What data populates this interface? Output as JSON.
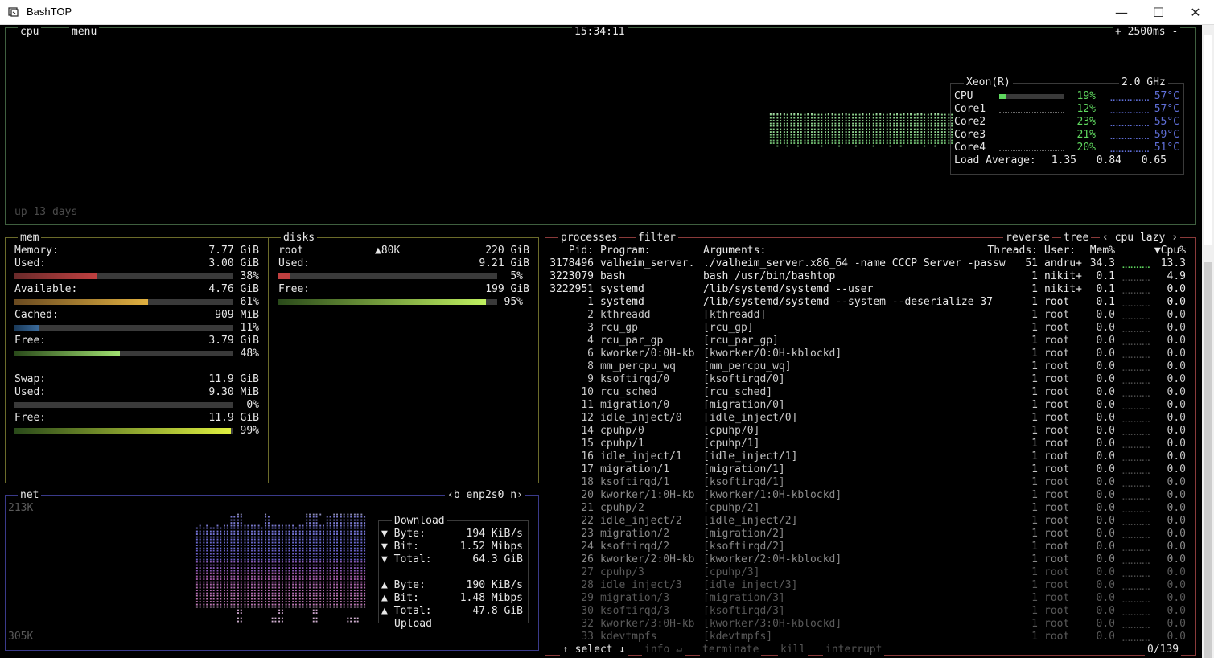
{
  "window": {
    "title": "BashTOP",
    "minimize": "—",
    "maximize": "☐",
    "close": "✕"
  },
  "cpu": {
    "label": "cpu",
    "menu": "menu",
    "clock": "15:34:11",
    "interval": "+ 2500ms -",
    "uptime": "up 13 days",
    "model": "Xeon(R)",
    "freq": "2.0 GHz",
    "rows": [
      {
        "name": "CPU",
        "pct": "19%",
        "temp": "57°C",
        "level": 0.19
      },
      {
        "name": "Core1",
        "pct": "12%",
        "temp": "57°C",
        "level": 0.12
      },
      {
        "name": "Core2",
        "pct": "23%",
        "temp": "55°C",
        "level": 0.23
      },
      {
        "name": "Core3",
        "pct": "21%",
        "temp": "59°C",
        "level": 0.21
      },
      {
        "name": "Core4",
        "pct": "20%",
        "temp": "51°C",
        "level": 0.2
      }
    ],
    "load_label": "Load Average:",
    "load": [
      "1.35",
      "0.84",
      "0.65"
    ]
  },
  "mem": {
    "label": "mem",
    "memory": {
      "label": "Memory:",
      "value": "7.77 GiB"
    },
    "used": {
      "label": "Used:",
      "value": "3.00 GiB",
      "pct": "38%",
      "level": 0.38
    },
    "available": {
      "label": "Available:",
      "value": "4.76 GiB",
      "pct": "61%",
      "level": 0.61
    },
    "cached": {
      "label": "Cached:",
      "value": "909 MiB",
      "pct": "11%",
      "level": 0.11
    },
    "free": {
      "label": "Free:",
      "value": "3.79 GiB",
      "pct": "48%",
      "level": 0.48
    },
    "swap": {
      "label": "Swap:",
      "value": "11.9 GiB"
    },
    "swap_used": {
      "label": "Used:",
      "value": "9.30 MiB",
      "pct": "0%",
      "level": 0.0
    },
    "swap_free": {
      "label": "Free:",
      "value": "11.9 GiB",
      "pct": "99%",
      "level": 0.99
    }
  },
  "disks": {
    "label": "disks",
    "name": "root",
    "io": "▲80K",
    "total": "220 GiB",
    "used": {
      "label": "Used:",
      "value": "9.21 GiB",
      "pct": "5%",
      "level": 0.05
    },
    "free": {
      "label": "Free:",
      "value": "199 GiB",
      "pct": "95%",
      "level": 0.95
    }
  },
  "net": {
    "label": "net",
    "interface": "‹b enp2s0 n›",
    "top_scale": "213K",
    "bottom_scale": "305K",
    "download": {
      "title": "Download",
      "byte_label": "▼ Byte:",
      "byte": "194 KiB/s",
      "bit_label": "▼ Bit:",
      "bit": "1.52 Mibps",
      "total_label": "▼ Total:",
      "total": "64.3 GiB"
    },
    "upload": {
      "title": "Upload",
      "byte_label": "▲ Byte:",
      "byte": "190 KiB/s",
      "bit_label": "▲ Bit:",
      "bit": "1.48 Mibps",
      "total_label": "▲ Total:",
      "total": "47.8 GiB"
    }
  },
  "proc": {
    "label": "processes",
    "filter": "filter",
    "reverse": "reverse",
    "tree": "tree",
    "sort": "‹ cpu lazy ›",
    "headers": {
      "pid": "Pid:",
      "program": "Program:",
      "args": "Arguments:",
      "threads": "Threads:",
      "user": "User:",
      "mem": "Mem%",
      "cpu": "▼Cpu%"
    },
    "rows": [
      {
        "pid": "3178496",
        "program": "valheim_server.",
        "args": "./valheim_server.x86_64 -name CCCP Server -passw",
        "threads": "51",
        "user": "andru+",
        "mem": "34.3",
        "cpu": "13.3"
      },
      {
        "pid": "3223079",
        "program": "bash",
        "args": "bash /usr/bin/bashtop",
        "threads": "1",
        "user": "nikit+",
        "mem": "0.1",
        "cpu": "4.9"
      },
      {
        "pid": "3222951",
        "program": "systemd",
        "args": "/lib/systemd/systemd --user",
        "threads": "1",
        "user": "nikit+",
        "mem": "0.1",
        "cpu": "0.0"
      },
      {
        "pid": "1",
        "program": "systemd",
        "args": "/lib/systemd/systemd --system --deserialize 37",
        "threads": "1",
        "user": "root",
        "mem": "0.1",
        "cpu": "0.0"
      },
      {
        "pid": "2",
        "program": "kthreadd",
        "args": "[kthreadd]",
        "threads": "1",
        "user": "root",
        "mem": "0.0",
        "cpu": "0.0"
      },
      {
        "pid": "3",
        "program": "rcu_gp",
        "args": "[rcu_gp]",
        "threads": "1",
        "user": "root",
        "mem": "0.0",
        "cpu": "0.0"
      },
      {
        "pid": "4",
        "program": "rcu_par_gp",
        "args": "[rcu_par_gp]",
        "threads": "1",
        "user": "root",
        "mem": "0.0",
        "cpu": "0.0"
      },
      {
        "pid": "6",
        "program": "kworker/0:0H-kb",
        "args": "[kworker/0:0H-kblockd]",
        "threads": "1",
        "user": "root",
        "mem": "0.0",
        "cpu": "0.0"
      },
      {
        "pid": "8",
        "program": "mm_percpu_wq",
        "args": "[mm_percpu_wq]",
        "threads": "1",
        "user": "root",
        "mem": "0.0",
        "cpu": "0.0"
      },
      {
        "pid": "9",
        "program": "ksoftirqd/0",
        "args": "[ksoftirqd/0]",
        "threads": "1",
        "user": "root",
        "mem": "0.0",
        "cpu": "0.0"
      },
      {
        "pid": "10",
        "program": "rcu_sched",
        "args": "[rcu_sched]",
        "threads": "1",
        "user": "root",
        "mem": "0.0",
        "cpu": "0.0"
      },
      {
        "pid": "11",
        "program": "migration/0",
        "args": "[migration/0]",
        "threads": "1",
        "user": "root",
        "mem": "0.0",
        "cpu": "0.0"
      },
      {
        "pid": "12",
        "program": "idle_inject/0",
        "args": "[idle_inject/0]",
        "threads": "1",
        "user": "root",
        "mem": "0.0",
        "cpu": "0.0"
      },
      {
        "pid": "14",
        "program": "cpuhp/0",
        "args": "[cpuhp/0]",
        "threads": "1",
        "user": "root",
        "mem": "0.0",
        "cpu": "0.0"
      },
      {
        "pid": "15",
        "program": "cpuhp/1",
        "args": "[cpuhp/1]",
        "threads": "1",
        "user": "root",
        "mem": "0.0",
        "cpu": "0.0"
      },
      {
        "pid": "16",
        "program": "idle_inject/1",
        "args": "[idle_inject/1]",
        "threads": "1",
        "user": "root",
        "mem": "0.0",
        "cpu": "0.0"
      },
      {
        "pid": "17",
        "program": "migration/1",
        "args": "[migration/1]",
        "threads": "1",
        "user": "root",
        "mem": "0.0",
        "cpu": "0.0"
      },
      {
        "pid": "18",
        "program": "ksoftirqd/1",
        "args": "[ksoftirqd/1]",
        "threads": "1",
        "user": "root",
        "mem": "0.0",
        "cpu": "0.0"
      },
      {
        "pid": "20",
        "program": "kworker/1:0H-kb",
        "args": "[kworker/1:0H-kblockd]",
        "threads": "1",
        "user": "root",
        "mem": "0.0",
        "cpu": "0.0"
      },
      {
        "pid": "21",
        "program": "cpuhp/2",
        "args": "[cpuhp/2]",
        "threads": "1",
        "user": "root",
        "mem": "0.0",
        "cpu": "0.0"
      },
      {
        "pid": "22",
        "program": "idle_inject/2",
        "args": "[idle_inject/2]",
        "threads": "1",
        "user": "root",
        "mem": "0.0",
        "cpu": "0.0"
      },
      {
        "pid": "23",
        "program": "migration/2",
        "args": "[migration/2]",
        "threads": "1",
        "user": "root",
        "mem": "0.0",
        "cpu": "0.0"
      },
      {
        "pid": "24",
        "program": "ksoftirqd/2",
        "args": "[ksoftirqd/2]",
        "threads": "1",
        "user": "root",
        "mem": "0.0",
        "cpu": "0.0"
      },
      {
        "pid": "26",
        "program": "kworker/2:0H-kb",
        "args": "[kworker/2:0H-kblockd]",
        "threads": "1",
        "user": "root",
        "mem": "0.0",
        "cpu": "0.0"
      },
      {
        "pid": "27",
        "program": "cpuhp/3",
        "args": "[cpuhp/3]",
        "threads": "1",
        "user": "root",
        "mem": "0.0",
        "cpu": "0.0"
      },
      {
        "pid": "28",
        "program": "idle_inject/3",
        "args": "[idle_inject/3]",
        "threads": "1",
        "user": "root",
        "mem": "0.0",
        "cpu": "0.0"
      },
      {
        "pid": "29",
        "program": "migration/3",
        "args": "[migration/3]",
        "threads": "1",
        "user": "root",
        "mem": "0.0",
        "cpu": "0.0"
      },
      {
        "pid": "30",
        "program": "ksoftirqd/3",
        "args": "[ksoftirqd/3]",
        "threads": "1",
        "user": "root",
        "mem": "0.0",
        "cpu": "0.0"
      },
      {
        "pid": "32",
        "program": "kworker/3:0H-kb",
        "args": "[kworker/3:0H-kblockd]",
        "threads": "1",
        "user": "root",
        "mem": "0.0",
        "cpu": "0.0"
      },
      {
        "pid": "33",
        "program": "kdevtmpfs",
        "args": "[kdevtmpfs]",
        "threads": "1",
        "user": "root",
        "mem": "0.0",
        "cpu": "0.0"
      }
    ],
    "footer": {
      "select": "↑ select ↓",
      "info": "info ↵",
      "terminate": "terminate",
      "kill": "kill",
      "interrupt": "interrupt",
      "count": "0/139"
    }
  },
  "colors": {
    "cpu_border": "#3f5f3f",
    "mem_border": "#6b6b2a",
    "net_border": "#3a3a8a",
    "proc_border": "#8a3a3a",
    "graph_green": "#8fd48f",
    "core_temp": "#5f6fd8"
  }
}
